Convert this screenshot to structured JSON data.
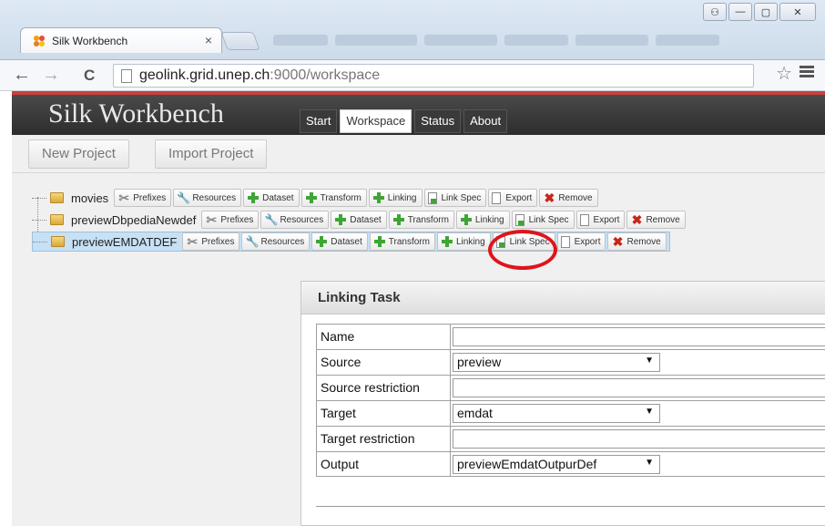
{
  "browser": {
    "tab_title": "Silk Workbench",
    "tab_close": "×",
    "url_host": "geolink.grid.unep.ch",
    "url_rest": ":9000/workspace",
    "back": "←",
    "forward": "→",
    "reload": "C",
    "star": "☆",
    "win_min": "—",
    "win_max": "▢",
    "win_close": "✕"
  },
  "app": {
    "brand": "Silk Workbench",
    "nav": [
      "Start",
      "Workspace",
      "Status",
      "About"
    ],
    "active_nav": "Workspace",
    "new_project": "New Project",
    "import_project": "Import Project"
  },
  "projects": [
    {
      "name": "movies",
      "buttons": [
        "Prefixes",
        "Resources",
        "Dataset",
        "Transform",
        "Linking",
        "Link Spec",
        "Export",
        "Remove"
      ]
    },
    {
      "name": "previewDbpediaNewdef",
      "buttons": [
        "Prefixes",
        "Resources",
        "Dataset",
        "Transform",
        "Linking",
        "Link Spec",
        "Export",
        "Remove"
      ]
    },
    {
      "name": "previewEMDATDEF",
      "buttons": [
        "Prefixes",
        "Resources",
        "Dataset",
        "Transform",
        "Linking",
        "Link Spec",
        "Export",
        "Remove"
      ]
    }
  ],
  "linking_task": {
    "title": "Linking Task",
    "rows": [
      {
        "label": "Name",
        "type": "input",
        "value": ""
      },
      {
        "label": "Source",
        "type": "select",
        "value": "preview"
      },
      {
        "label": "Source restriction",
        "type": "input",
        "value": ""
      },
      {
        "label": "Target",
        "type": "select",
        "value": "emdat"
      },
      {
        "label": "Target restriction",
        "type": "input",
        "value": ""
      },
      {
        "label": "Output",
        "type": "select",
        "value": "previewEmdatOutpurDef"
      }
    ]
  },
  "colors": {
    "accent_red": "#c9413a",
    "annotation_circle": "#e0141b",
    "plus_green": "#3fa535"
  }
}
